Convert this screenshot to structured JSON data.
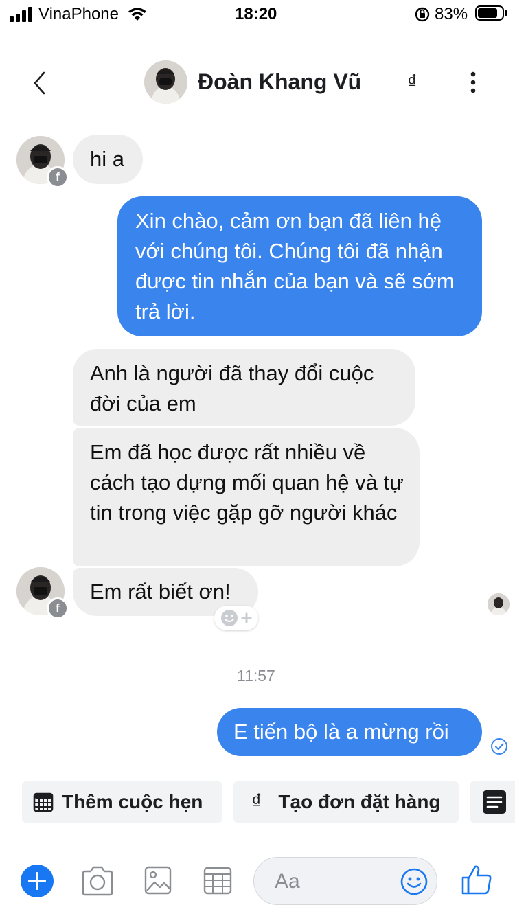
{
  "status_bar": {
    "carrier": "VinaPhone",
    "time": "18:20",
    "battery": "83%",
    "battery_level": 0.83
  },
  "header": {
    "contact_name": "Đoàn Khang Vũ",
    "currency_symbol": "₫",
    "icons": [
      "back-chevron-icon",
      "dong-icon",
      "more-vertical-icon"
    ]
  },
  "messages": [
    {
      "direction": "in",
      "text": "hi a"
    },
    {
      "direction": "out",
      "text": "Xin chào, cảm ơn bạn đã liên hệ với chúng tôi. Chúng tôi đã nhận được tin nhắn của bạn và sẽ sớm trả lời."
    },
    {
      "direction": "in",
      "text": "Anh là người đã thay đổi cuộc đời của em"
    },
    {
      "direction": "in",
      "text": "Em đã học được rất nhiều về cách tạo dựng mối quan hệ và tự tin trong việc gặp gỡ người khác"
    },
    {
      "direction": "in",
      "text": "Em rất biết ơn!"
    },
    {
      "direction": "out",
      "text": "E tiến bộ là a mừng rồi"
    }
  ],
  "timestamp": "11:57",
  "quick_actions": [
    {
      "label": "Thêm cuộc hẹn",
      "icon": "calendar-icon"
    },
    {
      "label": "Tạo đơn đặt hàng",
      "icon": "dong-icon"
    },
    {
      "label": "",
      "icon": "list-icon"
    }
  ],
  "composer": {
    "placeholder": "Aa",
    "icons": [
      "plus-icon",
      "camera-icon",
      "image-icon",
      "calendar-icon",
      "emoji-icon",
      "like-icon"
    ]
  },
  "colors": {
    "accent": "#1877f2",
    "outgoing_bubble": "#3a84ee",
    "incoming_bubble": "#eeeeee"
  }
}
